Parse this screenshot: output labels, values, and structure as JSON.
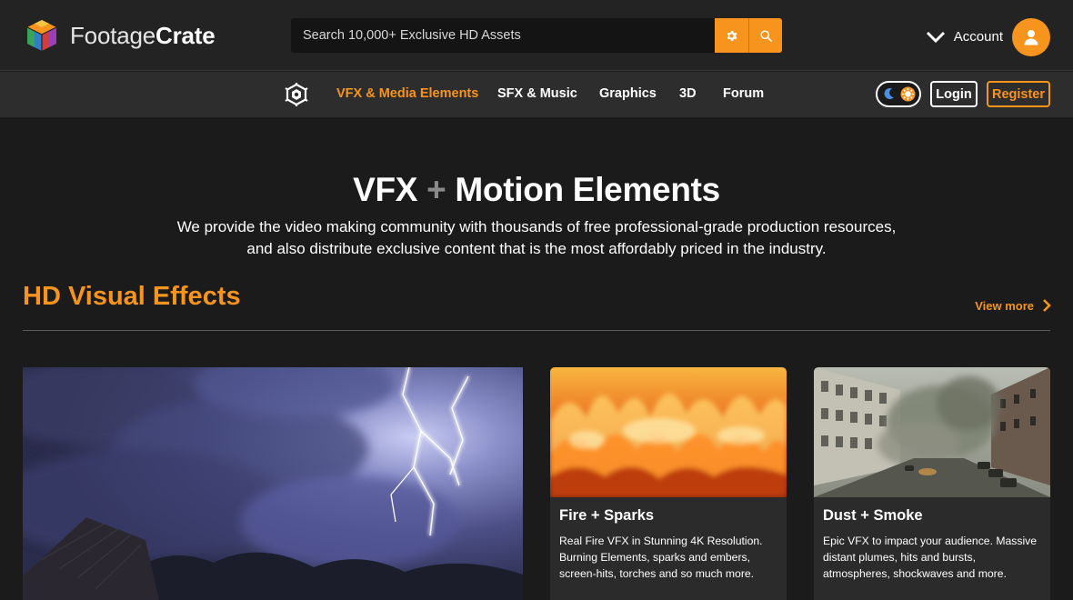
{
  "header": {
    "logo": {
      "text_light": "Footage",
      "text_bold": "Crate"
    },
    "search": {
      "placeholder": "Search 10,000+ Exclusive HD Assets",
      "settings_icon": "gear-icon",
      "search_icon": "search-icon"
    },
    "account": {
      "label": "Account",
      "icon": "user-icon"
    }
  },
  "nav": {
    "links": [
      {
        "label": "VFX & Media Elements",
        "active": true
      },
      {
        "label": "SFX & Music"
      },
      {
        "label": "Graphics"
      },
      {
        "label": "3D"
      },
      {
        "label": "Forum"
      }
    ],
    "login_label": "Login",
    "register_label": "Register"
  },
  "hero": {
    "title_part1": "VFX",
    "title_plus": "+",
    "title_part2": "Motion Elements",
    "line1": "We provide the video making community with thousands of free professional-grade production resources,",
    "line2": "and also distribute exclusive content that is the most affordably priced in the industry."
  },
  "section": {
    "title": "HD Visual Effects",
    "view_more": "View more"
  },
  "cards": [
    {
      "title": "Fire + Sparks",
      "desc": "Real Fire VFX in Stunning 4K Resolution. Burning Elements, sparks and embers, screen-hits, torches and so much more."
    },
    {
      "title": "Dust + Smoke",
      "desc": "Epic VFX to impact your audience. Massive distant plumes, hits and bursts, atmospheres, shockwaves and more."
    }
  ],
  "colors": {
    "accent": "#f7941d",
    "background": "#1b1b1b",
    "header": "#232323",
    "nav": "#2d2d2d",
    "card": "#2b2b2b"
  }
}
